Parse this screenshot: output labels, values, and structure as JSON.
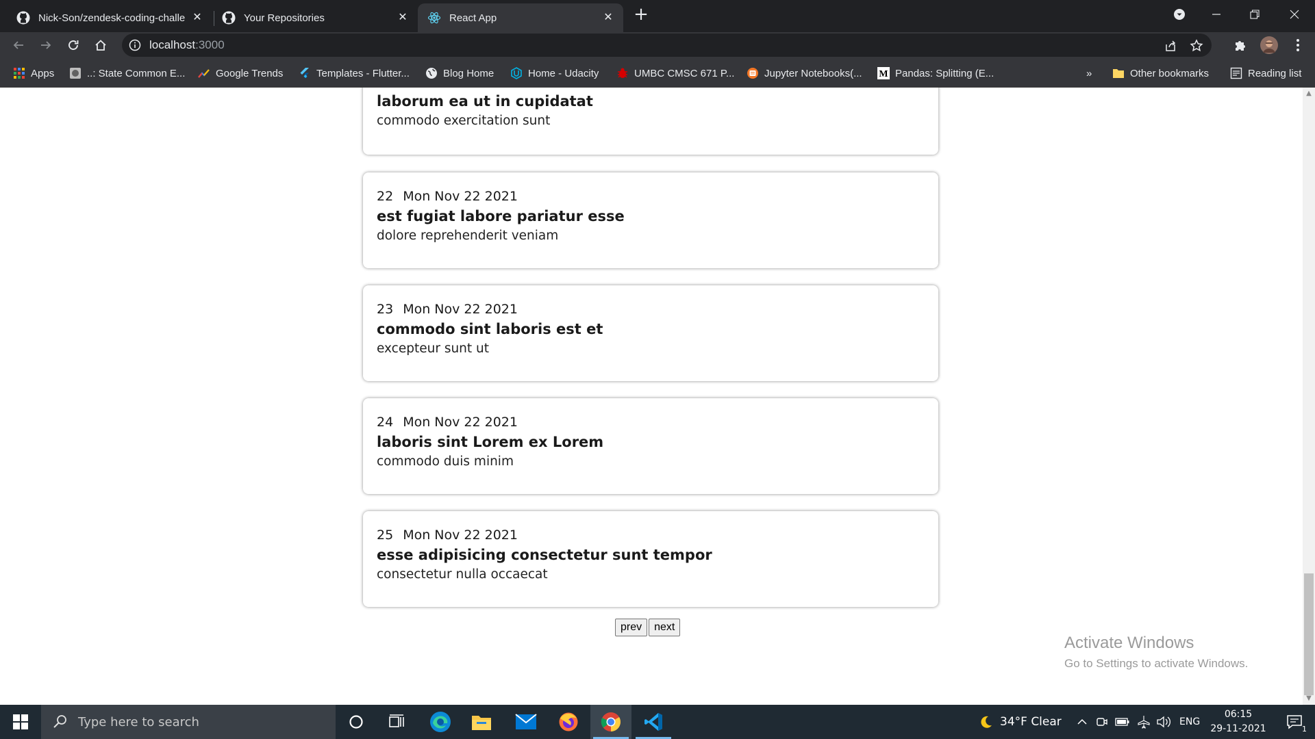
{
  "browser": {
    "tabs": [
      {
        "title": "Nick-Son/zendesk-coding-challe",
        "icon": "github-icon",
        "active": false
      },
      {
        "title": "Your Repositories",
        "icon": "github-icon",
        "active": false
      },
      {
        "title": "React App",
        "icon": "react-icon",
        "active": true
      }
    ],
    "url": {
      "host": "localhost",
      "port": ":3000"
    },
    "bookmarks": [
      {
        "label": "Apps",
        "icon": "apps-grid-icon"
      },
      {
        "label": "..: State Common E...",
        "icon": "site-icon"
      },
      {
        "label": "Google Trends",
        "icon": "google-trends-icon"
      },
      {
        "label": "Templates - Flutter...",
        "icon": "flutter-icon"
      },
      {
        "label": "Blog Home",
        "icon": "globe-icon"
      },
      {
        "label": "Home - Udacity",
        "icon": "udacity-icon"
      },
      {
        "label": "UMBC CMSC 671 P...",
        "icon": "bug-icon"
      },
      {
        "label": "Jupyter Notebooks(...",
        "icon": "jupyter-icon"
      },
      {
        "label": "Pandas: Splitting (E...",
        "icon": "medium-icon"
      }
    ],
    "overflow_label": "»",
    "other_bookmarks": "Other bookmarks",
    "reading_list": "Reading list"
  },
  "tickets": [
    {
      "id": "",
      "date": "",
      "subject": "laborum ea ut in cupidatat",
      "description": "commodo exercitation sunt"
    },
    {
      "id": "22",
      "date": "Mon Nov 22 2021",
      "subject": "est fugiat labore pariatur esse",
      "description": "dolore reprehenderit veniam"
    },
    {
      "id": "23",
      "date": "Mon Nov 22 2021",
      "subject": "commodo sint laboris est et",
      "description": "excepteur sunt ut"
    },
    {
      "id": "24",
      "date": "Mon Nov 22 2021",
      "subject": "laboris sint Lorem ex Lorem",
      "description": "commodo duis minim"
    },
    {
      "id": "25",
      "date": "Mon Nov 22 2021",
      "subject": "esse adipisicing consectetur sunt tempor",
      "description": "consectetur nulla occaecat"
    }
  ],
  "pagination": {
    "prev": "prev",
    "next": "next"
  },
  "watermark": {
    "line1": "Activate Windows",
    "line2": "Go to Settings to activate Windows."
  },
  "taskbar": {
    "search_placeholder": "Type here to search",
    "weather": "34°F  Clear",
    "language": "ENG",
    "time": "06:15",
    "date": "29-11-2021",
    "notification_count": "1"
  },
  "colors": {
    "chrome_dark": "#202124",
    "chrome_toolbar": "#35363a",
    "taskbar": "#1f2a33",
    "accent": "#76b9ed"
  }
}
